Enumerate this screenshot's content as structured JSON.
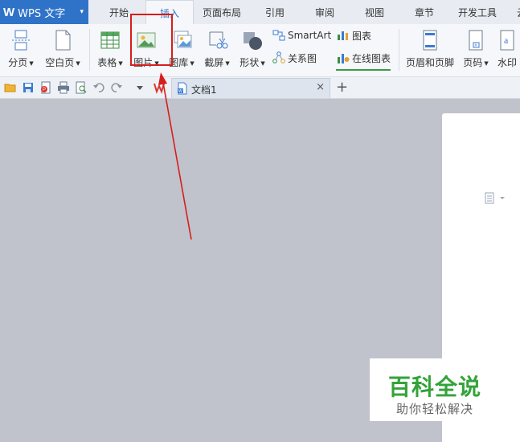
{
  "app": {
    "logo": "W",
    "name": "WPS 文字",
    "caret": "▾"
  },
  "tabs": [
    "开始",
    "插入",
    "页面布局",
    "引用",
    "审阅",
    "视图",
    "章节",
    "开发工具",
    "云"
  ],
  "ribbon": {
    "page_break": "分页",
    "blank_page": "空白页",
    "table": "表格",
    "picture": "图片",
    "gallery": "图库",
    "screenshot": "截屏",
    "shapes": "形状",
    "smartart": "SmartArt",
    "chart": "图表",
    "relation_chart": "关系图",
    "online_chart": "在线图表",
    "header_footer": "页眉和页脚",
    "page_number": "页码",
    "watermark": "水印",
    "dropdown_glyph": "▼"
  },
  "document_tab": {
    "name": "文档1",
    "close": "×",
    "new_tab": "+"
  },
  "watermark_overlay": {
    "title": "百科全说",
    "subtitle": "助你轻松解决"
  },
  "colors": {
    "app_blue": "#2f73c9",
    "annotation_red": "#d71d1d",
    "watermark_green": "#33a33a",
    "workspace": "#c0c3cb"
  }
}
